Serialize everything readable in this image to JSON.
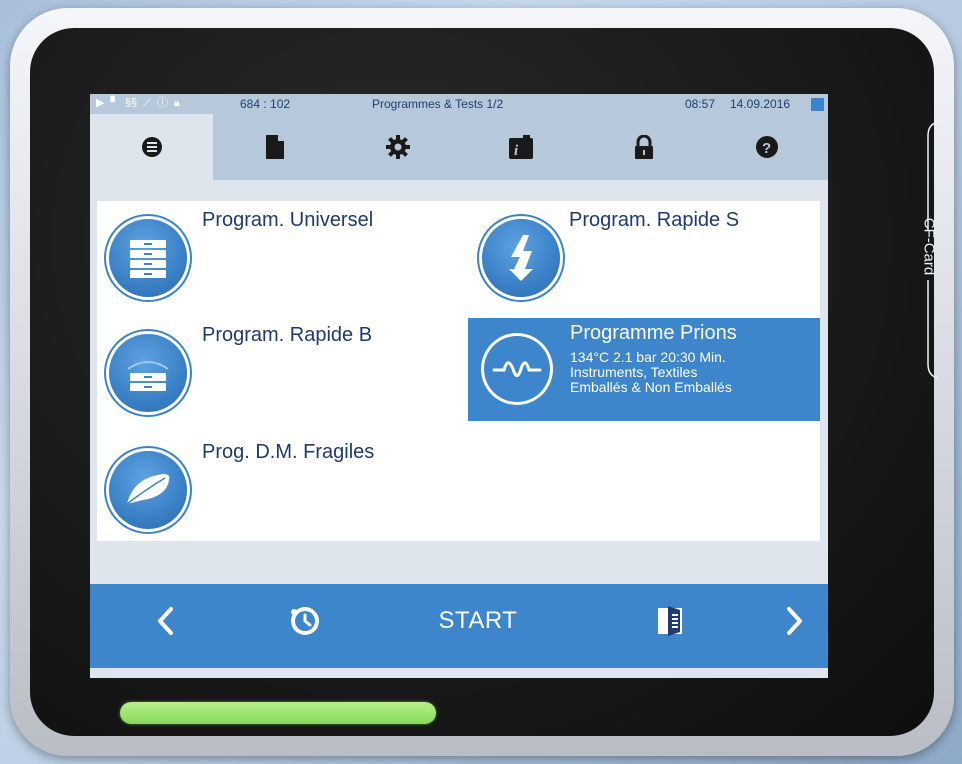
{
  "status": {
    "icons": [
      "play-icon",
      "document-icon",
      "steam-icon",
      "chart-icon",
      "info-icon",
      "lock-icon"
    ],
    "counter": "684 : 102",
    "title": "Programmes & Tests 1/2",
    "time": "08:57",
    "date": "14.09.2016"
  },
  "tabs": [
    {
      "name": "tab-programs",
      "icon": "list-icon",
      "active": true
    },
    {
      "name": "tab-logs",
      "icon": "document-icon",
      "active": false
    },
    {
      "name": "tab-settings",
      "icon": "gear-icon",
      "active": false
    },
    {
      "name": "tab-info",
      "icon": "info-icon",
      "active": false
    },
    {
      "name": "tab-lock",
      "icon": "lock-icon",
      "active": false
    },
    {
      "name": "tab-help",
      "icon": "help-icon",
      "active": false
    }
  ],
  "programs": {
    "universel": {
      "label": "Program. Universel",
      "icon": "stacked-trays-icon"
    },
    "rapide_s": {
      "label": "Program. Rapide S",
      "icon": "lightning-icon"
    },
    "rapide_b": {
      "label": "Program. Rapide B",
      "icon": "single-tray-icon"
    },
    "prions": {
      "label": "Programme Prions",
      "icon": "wave-icon",
      "selected": true,
      "line1": "134°C 2.1 bar 20:30 Min.",
      "line2": "Instruments, Textiles",
      "line3": "Emballés & Non Emballés"
    },
    "fragiles": {
      "label": "Prog. D.M. Fragiles",
      "icon": "feather-icon"
    }
  },
  "bottom": {
    "start_label": "START",
    "icons": [
      "chevron-left-icon",
      "timer-icon",
      "door-icon",
      "chevron-right-icon"
    ]
  },
  "device": {
    "cf_card_label": "CF-Card"
  },
  "colors": {
    "accent": "#3d86cc",
    "status_bar": "#b7c8da",
    "text_dark": "#1e3a6e",
    "indicator_green": "#86d85a"
  }
}
